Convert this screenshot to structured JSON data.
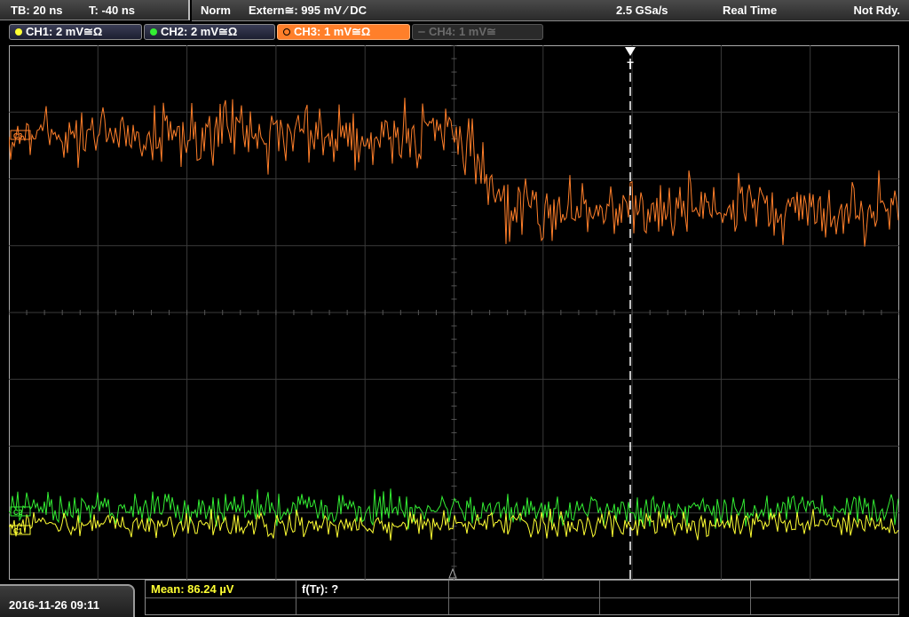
{
  "topbar": {
    "timebase": "TB: 20 ns",
    "trigger_offset": "T: -40 ns",
    "acq_mode": "Norm",
    "trigger_source": "Extern≅: 995 mV ⁄ DC",
    "sample_rate": "2.5 GSa/s",
    "realtime": "Real Time",
    "status": "Not Rdy."
  },
  "channels": [
    {
      "label": "CH1: 2 mV≅Ω",
      "color": "#ffff33",
      "active": true
    },
    {
      "label": "CH2: 2 mV≅Ω",
      "color": "#33ee33",
      "active": true
    },
    {
      "label": "CH3: 1 mV≅Ω",
      "color": "#ff7f2a",
      "active": true
    },
    {
      "label": "CH4: 1 mV≅",
      "color": "#666666",
      "active": false
    }
  ],
  "markers": {
    "ch3": "C3",
    "ch2": "C2",
    "ch1": "C1",
    "trigger": "T"
  },
  "measurements": {
    "mean": "Mean: 86.24 µV",
    "rise_freq": "f(Tr): ?"
  },
  "datetime": "2016-11-26 09:11"
}
